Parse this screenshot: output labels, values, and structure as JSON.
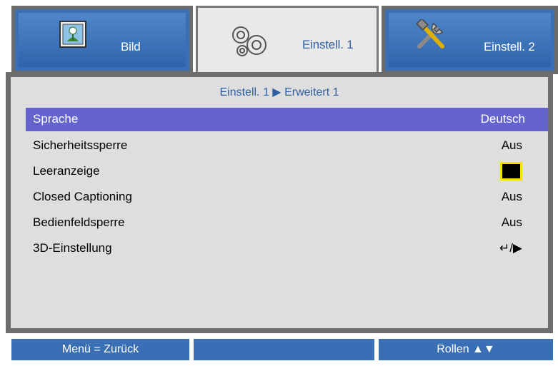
{
  "tabs": [
    {
      "label": "Bild",
      "icon": "picture-icon"
    },
    {
      "label": "Einstell. 1",
      "icon": "gears-icon"
    },
    {
      "label": "Einstell. 2",
      "icon": "tools-icon"
    }
  ],
  "breadcrumb": {
    "part1": "Einstell. 1",
    "separator": "▶",
    "part2": "Erweitert 1"
  },
  "menu": {
    "items": [
      {
        "label": "Sprache",
        "value": "Deutsch",
        "selected": true
      },
      {
        "label": "Sicherheitssperre",
        "value": "Aus"
      },
      {
        "label": "Leeranzeige",
        "value_color": "#000000"
      },
      {
        "label": "Closed Captioning",
        "value": "Aus"
      },
      {
        "label": "Bedienfeldsperre",
        "value": "Aus"
      },
      {
        "label": "3D-Einstellung",
        "value": "↵/▶"
      }
    ]
  },
  "footer": {
    "back": "Menü = Zurück",
    "scroll": "Rollen ▲▼"
  },
  "colors": {
    "accent_blue": "#3a6fb5",
    "selection": "#6464cc",
    "highlight_text": "#2f5fa3"
  }
}
